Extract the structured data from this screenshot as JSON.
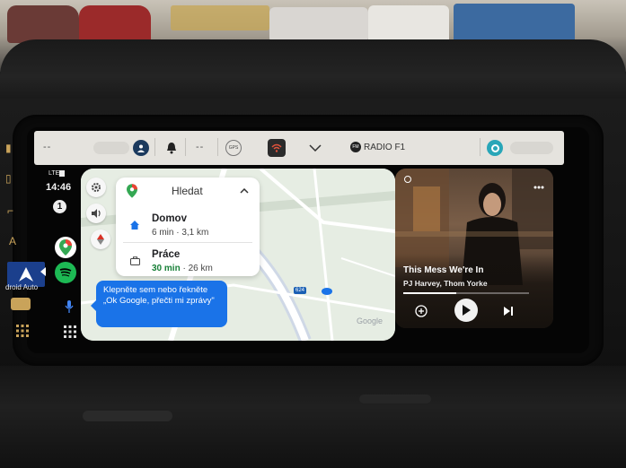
{
  "statusbar": {
    "left_dashes": "--",
    "mid_dashes": "--",
    "gps_label": "GPS",
    "fm_badge": "FM",
    "radio_station": "RADIO F1"
  },
  "rail": {
    "network": "LTE",
    "time": "14:46",
    "notification_count": "1"
  },
  "car_os": {
    "android_auto_label": "droid Auto"
  },
  "search": {
    "title": "Hledat",
    "destinations": [
      {
        "name": "Domov",
        "duration": "6 min",
        "distance": "· 3,1 km"
      },
      {
        "name": "Práce",
        "duration": "30 min",
        "distance": "· 26 km"
      }
    ]
  },
  "assistant": {
    "hint": "Klepněte sem nebo řekněte „Ok Google, přečti mi zprávy\""
  },
  "map": {
    "attribution": "Google",
    "road_number": "624"
  },
  "media": {
    "title": "This Mess We're In",
    "artist": "PJ Harvey, Thom Yorke",
    "progress": 0.42
  },
  "icons": {
    "settings": "gear-icon",
    "volume": "volume-icon",
    "compass": "compass-icon",
    "home": "home-icon",
    "work": "briefcase-icon",
    "maps_app": "google-maps-icon",
    "spotify_app": "spotify-icon",
    "mic": "mic-icon",
    "launcher": "app-grid-icon"
  },
  "colors": {
    "accent_blue": "#1a73e8",
    "spotify_green": "#1db954",
    "eta_green": "#188038",
    "statusbar_bg": "#e5e3de",
    "map_bg": "#e6ede3"
  }
}
